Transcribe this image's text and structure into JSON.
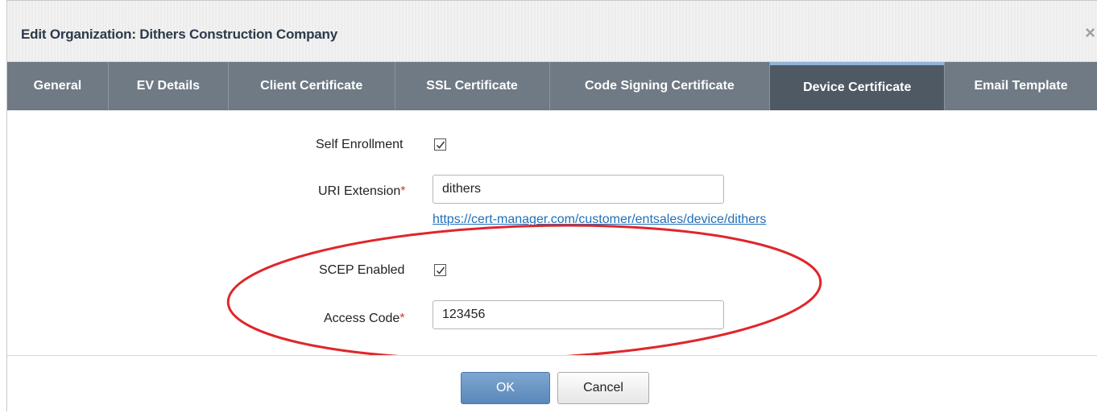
{
  "dialog": {
    "title": "Edit Organization: Dithers Construction Company",
    "close_glyph": "×"
  },
  "tabs": [
    {
      "label": "General",
      "active": false
    },
    {
      "label": "EV Details",
      "active": false
    },
    {
      "label": "Client Certificate",
      "active": false
    },
    {
      "label": "SSL Certificate",
      "active": false
    },
    {
      "label": "Code Signing Certificate",
      "active": false
    },
    {
      "label": "Device Certificate",
      "active": true
    },
    {
      "label": "Email Template",
      "active": false
    }
  ],
  "form": {
    "self_enrollment": {
      "label": "Self Enrollment",
      "checked": true
    },
    "uri_extension": {
      "label": "URI Extension",
      "required_mark": "*",
      "value": "dithers",
      "link": "https://cert-manager.com/customer/entsales/device/dithers"
    },
    "scep_enabled": {
      "label": "SCEP Enabled",
      "checked": true
    },
    "access_code": {
      "label": "Access Code",
      "required_mark": "*",
      "value": "123456"
    }
  },
  "footer": {
    "ok_label": "OK",
    "cancel_label": "Cancel"
  },
  "colors": {
    "tab_bar": "#6f7a85",
    "tab_active": "#4f5963",
    "ok_button": "#5a88ba",
    "highlight_ellipse": "#e0262a",
    "required": "#d9362b",
    "link": "#1f6fb8"
  },
  "icons": {
    "close": "close-icon",
    "checkmark": "checkmark-icon"
  }
}
